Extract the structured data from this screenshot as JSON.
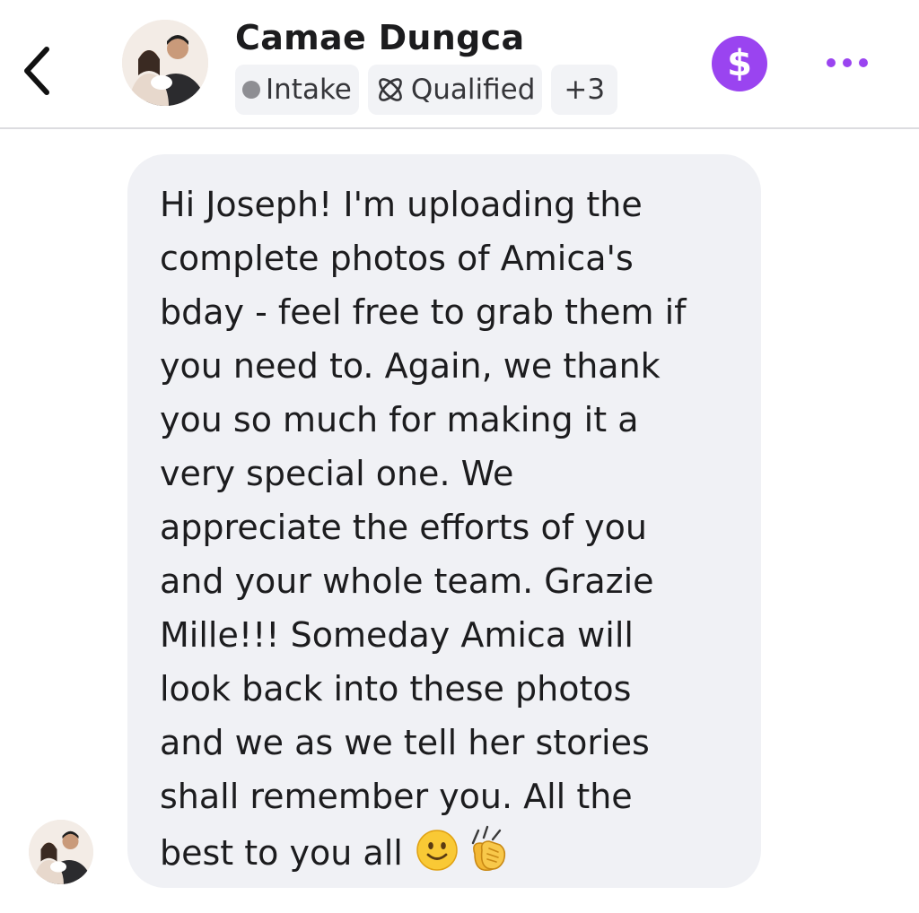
{
  "header": {
    "contact_name": "Camae Dungca",
    "tags": [
      {
        "label": "Intake",
        "icon": "grey-dot-icon"
      },
      {
        "label": "Qualified",
        "icon": "atom-icon"
      },
      {
        "label": "+3"
      }
    ],
    "back_icon": "chevron-left-icon",
    "payment_icon": "dollar-icon",
    "payment_glyph": "$",
    "more_icon": "ellipsis-icon",
    "accent_color": "#9a44f0"
  },
  "message": {
    "lines": [
      "Hi Joseph! I'm uploading the",
      "complete photos of Amica's",
      "bday - feel free to grab them if",
      "you need to. Again, we thank",
      "you so much for making it a",
      "very special one. We",
      "appreciate the efforts of you",
      "and your whole team. Grazie",
      "Mille!!! Someday Amica will",
      "look back into these photos",
      "and we as we tell her stories",
      "shall remember you. All the",
      "best to you all"
    ],
    "emojis": [
      "slightly-smiling-face",
      "clapping-hands"
    ],
    "bubble_color": "#f0f1f5"
  }
}
